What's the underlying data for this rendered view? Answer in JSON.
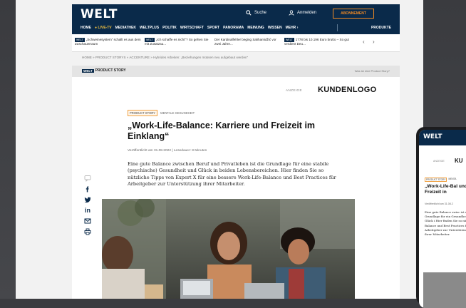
{
  "header": {
    "logo": "WELT",
    "search_label": "Suche",
    "login_label": "Anmelden",
    "abo_label": "ABONNEMENT",
    "nav": [
      "HOME",
      "LIVE-TV",
      "MEDIATHEK",
      "WELTPLUS",
      "POLITIK",
      "WIRTSCHAFT",
      "SPORT",
      "PANORAMA",
      "MEINUNG",
      "WISSEN",
      "MEHR"
    ],
    "produkte_label": "PRODUKTE"
  },
  "teasers": [
    {
      "badge": "WELT",
      "text": "„Schweinesystem“ schallt es aus dem Zuschauerraum"
    },
    {
      "badge": "WELT",
      "text": "„Ich schaffe es nicht“? So gehen Sie mit Zusatzau..."
    },
    {
      "badge": "",
      "text": "Der Kardinalfehler beging Salihamidžić vor zwei Jahre..."
    },
    {
      "badge": "WELT",
      "text": "1778 bis 10.196 Euro brutto – So gut verdient Deu..."
    }
  ],
  "breadcrumb": "HOME » PRODUCT STORYS » ACCENTURE » Hybrides Arbeiten: „Beziehungen müssen neu aufgebaut werden“",
  "product_story": {
    "badge_w": "WELT",
    "label": "PRODUCT STORY",
    "info": "Was ist eine Product Story?"
  },
  "article": {
    "anzeige": "ANZEIGE",
    "kundenlogo": "KUNDENLOGO",
    "tag_primary": "PRODUCT STORY",
    "tag_secondary": "MENTALE GESUNDHEIT",
    "title": "„Work-Life-Balance: Karriere und Freizeit im Einklang“",
    "meta": "Veröffentlicht am 31.08.2022 | Lesedauer: 8 Minuten",
    "lead": "Eine gute Balance zwischen Beruf und Privatleben ist die Grundlage für eine stabile (psychische) Gesundheit und Glück in beiden Lebensbereichen. Hier finden Sie so nützliche Tipps von Expert X für eine bessere Work-Life-Balance und Best Practices für Arbeitgeber zur Unterstützung ihrer Mitarbeiter."
  },
  "share_icons": [
    "comment-icon",
    "facebook-icon",
    "twitter-icon",
    "linkedin-icon",
    "email-icon",
    "print-icon"
  ],
  "phone": {
    "logo": "WELT",
    "anzeige": "ANZEIGE",
    "kundenlogo": "KU",
    "tag_primary": "PRODUCT STORY",
    "tag_secondary": "MENTA",
    "title": "„Work-Life-Bal und Freizeit in",
    "meta": "Veröffentlicht am 31.08.2",
    "lead": "Eine gute Balance zwisc ist die Grundlage für ein Gesundheit und Glück i Hier finden Sie so nütz Balance und Best Practices für Arbeitgeber zur Unterstützung ihrer Mitarbeiter."
  },
  "colors": {
    "brand_navy": "#0a2a4a",
    "accent_orange": "#f08a24",
    "live_yellow": "#f0c040"
  }
}
